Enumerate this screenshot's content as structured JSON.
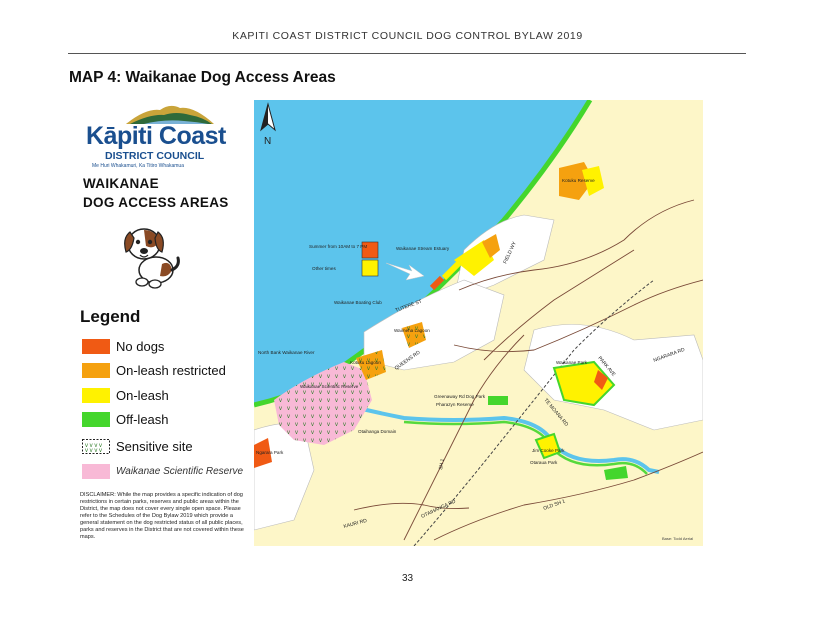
{
  "header": {
    "text": "KAPITI COAST DISTRICT COUNCIL DOG CONTROL BYLAW 2019"
  },
  "map_title": "MAP 4:  Waikanae Dog Access Areas",
  "logo": {
    "name": "Kāpiti Coast",
    "subtitle": "DISTRICT COUNCIL",
    "tagline": "Me Huri Whakamuri, Ka Titiro Whakamua"
  },
  "area_title": {
    "line1": "WAIKANAE",
    "line2": "DOG ACCESS AREAS"
  },
  "legend": {
    "title": "Legend",
    "items": [
      {
        "label": "No dogs",
        "color": "#f05a14"
      },
      {
        "label": "On-leash restricted",
        "color": "#f5a10f"
      },
      {
        "label": "On-leash",
        "color": "#fff200"
      },
      {
        "label": "Off-leash",
        "color": "#44d62c"
      },
      {
        "label": "Sensitive site",
        "color": "#ffffff"
      },
      {
        "label": "Waikanae Scientific Reserve",
        "color": "#f8b9d6"
      }
    ]
  },
  "disclaimer": "DISCLAIMER: While the map provides a specific indication of dog restrictions in certain parks, reserves and public areas within the District, the map does not cover every single open space. Please refer to the Schedules of the Dog Bylaw 2019 which provide a general statement on the dog restricted status of all public places, parks and reserves in the District that are not covered within these maps.",
  "map": {
    "north_label": "N",
    "inset": {
      "summer": "Summer from 10AM to 7 PM",
      "other": "Other times"
    },
    "places": {
      "kotuku_reserve": "Kotuku Reserve",
      "stream_estuary": "Waikanae Stream Estuary",
      "boating_club": "Waikanae Boating Club",
      "lagoon": "Waimeha Lagoon",
      "river_north": "North Bank Waikanae River",
      "kotuku_lagoon": "Kotuku Lagoon",
      "scientific_reserve": "Waikanae Scientific Reserve",
      "otaihanga_domain": "Otaihanga Domain",
      "greenaway_park": "Greenaway Rd Dog Park",
      "pharazyn_reserve": "Pharazyn Reserve",
      "waikanae_park": "Waikanae Park",
      "jim_cooke_park": "Jim Cooke Park",
      "otaraua_park": "Otaraua Park",
      "ngarara_park": "Ngarara Park",
      "field_way": "FIELD WY",
      "te_moana_rd": "TE MOANA RD",
      "queens_rd": "QUEENS RD",
      "tutere_st": "TUTERE ST",
      "park_ave": "PARK AVE",
      "ngarara_rd": "NGARARA RD",
      "sh1": "SH 1",
      "kauri_rd": "KAURI RD",
      "otaihanga_rd": "OTAIHANGA RD",
      "old_sh1": "OLD SH 1",
      "credit": "Base: Todd Aerial"
    }
  },
  "page_number": "33"
}
